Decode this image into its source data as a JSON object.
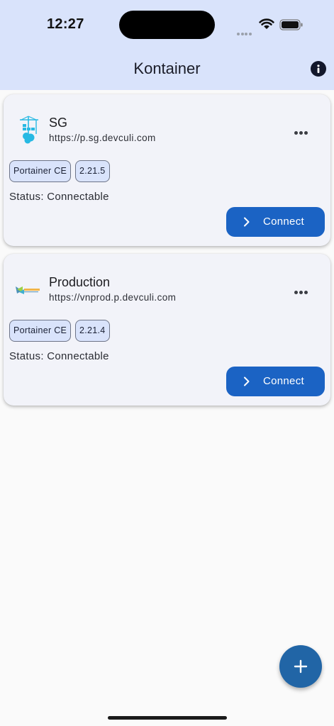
{
  "status_bar": {
    "time": "12:27"
  },
  "app_bar": {
    "title": "Kontainer",
    "info_icon": "info-icon"
  },
  "environments": [
    {
      "name": "SG",
      "url": "https://p.sg.devculi.com",
      "platform": "Portainer CE",
      "version": "2.21.5",
      "status": "Status: Connectable",
      "action_label": "Connect",
      "logo_icon": "docker-crane-logo-icon"
    },
    {
      "name": "Production",
      "url": "https://vnprod.p.devculi.com",
      "platform": "Portainer CE",
      "version": "2.21.4",
      "status": "Status: Connectable",
      "action_label": "Connect",
      "logo_icon": "devculi-logo-icon"
    }
  ],
  "fab": {
    "icon": "plus-icon"
  },
  "colors": {
    "app_bar_bg": "#d9e3fb",
    "card_bg": "#f2f3f9",
    "primary_button": "#1b63c4",
    "fab": "#2165a6",
    "chip_bg": "#d9e3fb"
  }
}
